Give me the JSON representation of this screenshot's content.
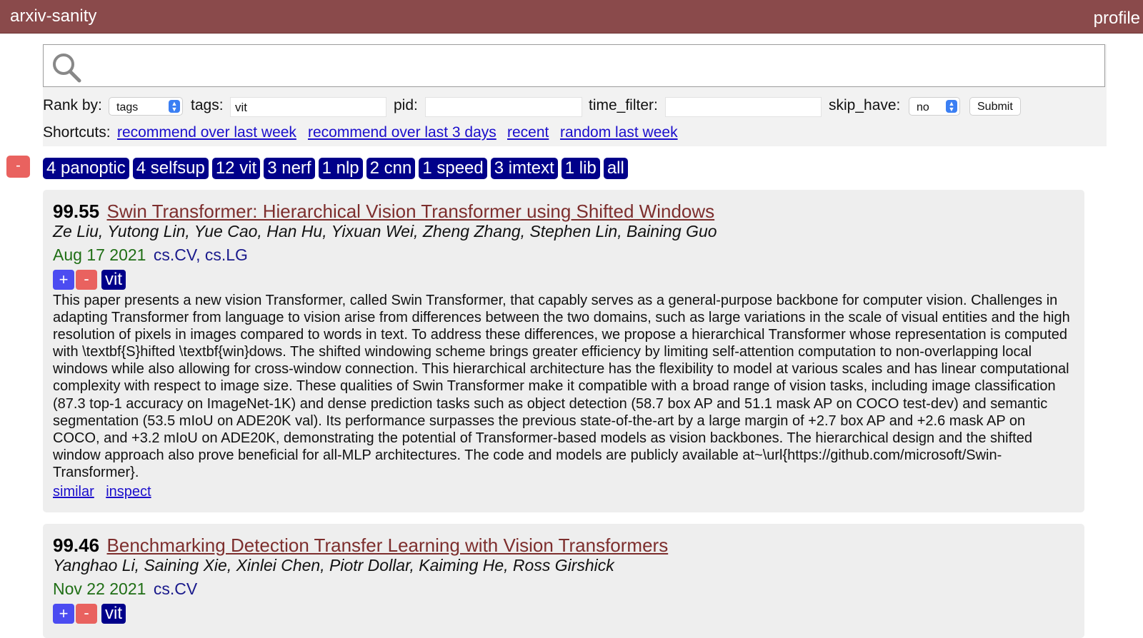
{
  "header": {
    "brand": "arxiv-sanity",
    "profile": "profile"
  },
  "search": {
    "value": "",
    "placeholder": ""
  },
  "controls": {
    "rank_by_label": "Rank by:",
    "rank_by_value": "tags",
    "tags_label": "tags:",
    "tags_value": "vit",
    "pid_label": "pid:",
    "pid_value": "",
    "time_filter_label": "time_filter:",
    "time_filter_value": "",
    "skip_have_label": "skip_have:",
    "skip_have_value": "no",
    "submit_label": "Submit"
  },
  "shortcuts": {
    "label": "Shortcuts:",
    "links": [
      "recommend over last week",
      "recommend over last 3 days",
      "recent",
      "random last week"
    ]
  },
  "tagbar": {
    "minus": "-",
    "tags": [
      "4 panoptic",
      "4 selfsup",
      "12 vit",
      "3 nerf",
      "1 nlp",
      "2 cnn",
      "1 speed",
      "3 imtext",
      "1 lib",
      "all"
    ]
  },
  "papers": [
    {
      "score": "99.55",
      "title": "Swin Transformer: Hierarchical Vision Transformer using Shifted Windows",
      "authors": "Ze Liu, Yutong Lin, Yue Cao, Han Hu, Yixuan Wei, Zheng Zhang, Stephen Lin, Baining Guo",
      "date": "Aug 17 2021",
      "categories": "cs.CV, cs.LG",
      "plus": "+",
      "minus": "-",
      "tag": "vit",
      "abstract": "This paper presents a new vision Transformer, called Swin Transformer, that capably serves as a general-purpose backbone for computer vision. Challenges in adapting Transformer from language to vision arise from differences between the two domains, such as large variations in the scale of visual entities and the high resolution of pixels in images compared to words in text. To address these differences, we propose a hierarchical Transformer whose representation is computed with \\textbf{S}hifted \\textbf{win}dows. The shifted windowing scheme brings greater efficiency by limiting self-attention computation to non-overlapping local windows while also allowing for cross-window connection. This hierarchical architecture has the flexibility to model at various scales and has linear computational complexity with respect to image size. These qualities of Swin Transformer make it compatible with a broad range of vision tasks, including image classification (87.3 top-1 accuracy on ImageNet-1K) and dense prediction tasks such as object detection (58.7 box AP and 51.1 mask AP on COCO test-dev) and semantic segmentation (53.5 mIoU on ADE20K val). Its performance surpasses the previous state-of-the-art by a large margin of +2.7 box AP and +2.6 mask AP on COCO, and +3.2 mIoU on ADE20K, demonstrating the potential of Transformer-based models as vision backbones. The hierarchical design and the shifted window approach also prove beneficial for all-MLP architectures. The code and models are publicly available at~\\url{https://github.com/microsoft/Swin-Transformer}.",
      "similar": "similar",
      "inspect": "inspect"
    },
    {
      "score": "99.46",
      "title": "Benchmarking Detection Transfer Learning with Vision Transformers",
      "authors": "Yanghao Li, Saining Xie, Xinlei Chen, Piotr Dollar, Kaiming He, Ross Girshick",
      "date": "Nov 22 2021",
      "categories": "cs.CV",
      "plus": "+",
      "minus": "-",
      "tag": "vit"
    }
  ],
  "colors": {
    "header_bg": "#8a4a4b",
    "tag_bg": "#00008a",
    "minus_bg": "#e9625f",
    "plus_bg": "#4c4cf1",
    "title_link": "#7d2e2d",
    "date": "#1f6e15",
    "link": "#1a0dcc"
  }
}
